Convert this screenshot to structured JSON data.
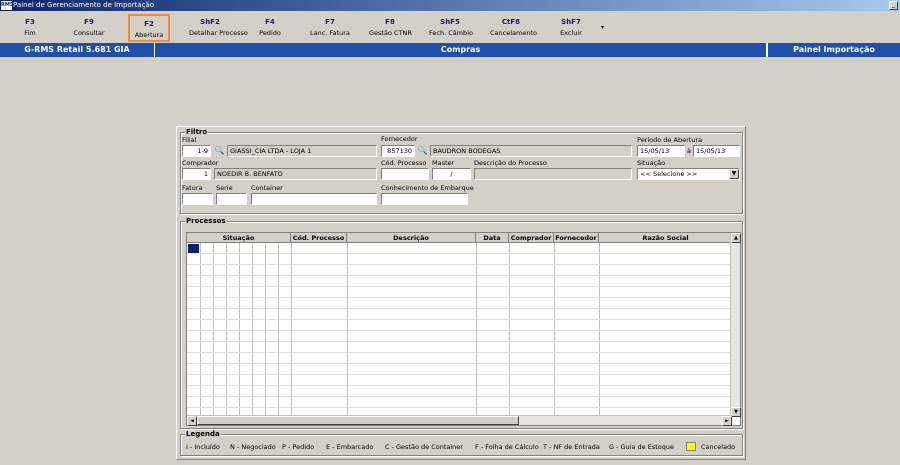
{
  "window": {
    "title": "Painel de Gerenciamento de Importação",
    "icon": "app-icon",
    "minimize_glyph": "_"
  },
  "toolbar": {
    "buttons": [
      {
        "key": "F3",
        "label": "Fim"
      },
      {
        "key": "F9",
        "label": "Consultar"
      },
      {
        "key": "F2",
        "label": "Abertura",
        "selected": true
      },
      {
        "key": "ShF2",
        "label": "Detalhar Processo"
      },
      {
        "key": "F4",
        "label": "Pedido"
      },
      {
        "key": "F7",
        "label": "Lanc. Fatura"
      },
      {
        "key": "F8",
        "label": "Gestão CTNR"
      },
      {
        "key": "ShF5",
        "label": "Fech. Câmbio"
      },
      {
        "key": "CtF8",
        "label": "Cancelamento"
      },
      {
        "key": "ShF7",
        "label": "Excluir"
      }
    ],
    "more_glyph": "▾",
    "highlight_color": "#f08a3c"
  },
  "header_bar": {
    "left": "G-RMS Retail 5.681 GIA",
    "center": "Compras",
    "right": "Painel Importação",
    "color": "#1f4fa8"
  },
  "filtro": {
    "title": "Filtro",
    "filial": {
      "label": "Filial",
      "code": "1-9",
      "name": "GIASSI_CIA LTDA - LOJA 1"
    },
    "fornecedor": {
      "label": "Fornecedor",
      "code": "857130",
      "name": "BAUDRON BODEGAS"
    },
    "periodo": {
      "label": "Período de Abertura",
      "from": "15/05/13",
      "sep": "à",
      "to": "15/05/13"
    },
    "comprador": {
      "label": "Comprador",
      "code": "1",
      "name": "NOEDIR B. BENFATO"
    },
    "cod_processo": {
      "label": "Cód. Processo",
      "value": ""
    },
    "master": {
      "label": "Master",
      "value": "/"
    },
    "descricao_processo": {
      "label": "Descrição do Processo",
      "value": ""
    },
    "situacao": {
      "label": "Situação",
      "value": "<< Selecione >>"
    },
    "fatura": {
      "label": "Fatura",
      "value": ""
    },
    "serie": {
      "label": "Serie",
      "value": ""
    },
    "container": {
      "label": "Container",
      "value": ""
    },
    "conhecimento": {
      "label": "Conhecimento de Embarque",
      "value": ""
    }
  },
  "processos": {
    "title": "Processos",
    "columns": [
      "Situação",
      "Cód. Processo",
      "Descrição",
      "Data",
      "Comprador",
      "Fornecedor",
      "Razão Social"
    ],
    "rows": [],
    "scroll_up": "▲",
    "scroll_down": "▼",
    "scroll_left": "◄",
    "scroll_right": "►"
  },
  "legenda": {
    "title": "Legenda",
    "items": [
      "I - Incluído",
      "N - Negociado",
      "P - Pedido",
      "E - Embarcado",
      "C - Gestão de Container",
      "F - Folha de Cálculo",
      "T - NF de Entrada",
      "G - Guia de Estoque"
    ],
    "cancelado": {
      "label": "Cancelado",
      "color": "#ffff00"
    }
  }
}
